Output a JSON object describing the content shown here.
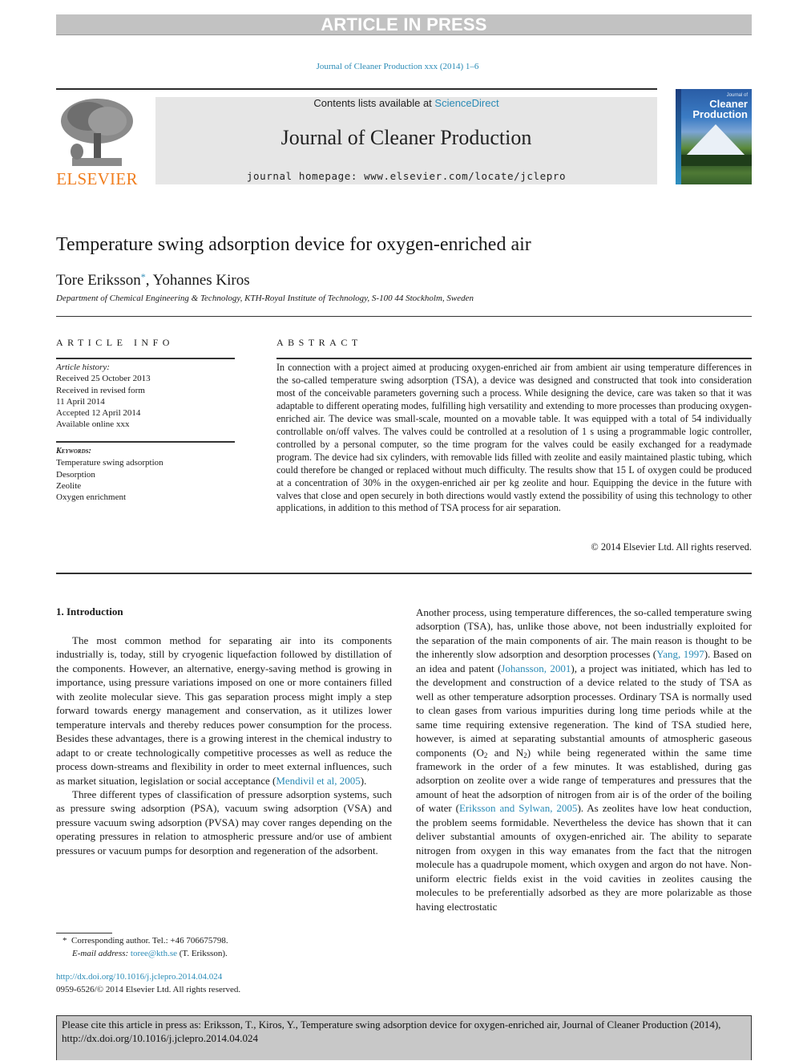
{
  "banner": {
    "text": "ARTICLE IN PRESS"
  },
  "journal_ref": "Journal of Cleaner Production xxx (2014) 1–6",
  "masthead": {
    "publisher_logo_text": "ELSEVIER",
    "contents_prefix": "Contents lists available at ",
    "contents_link": "ScienceDirect",
    "journal_title": "Journal of Cleaner Production",
    "homepage": "journal homepage: www.elsevier.com/locate/jclepro",
    "cover": {
      "small": "Journal of",
      "line1": "Cleaner",
      "line2": "Production"
    }
  },
  "article": {
    "title": "Temperature swing adsorption device for oxygen-enriched air",
    "author1": "Tore Eriksson",
    "author_marker": "*",
    "author_sep": ", ",
    "author2": "Yohannes Kiros",
    "affiliation": "Department of Chemical Engineering & Technology, KTH-Royal Institute of Technology, S-100 44 Stockholm, Sweden"
  },
  "article_info": {
    "heading": "ARTICLE INFO",
    "history_label": "Article history:",
    "history": [
      "Received 25 October 2013",
      "Received in revised form",
      "11 April 2014",
      "Accepted 12 April 2014",
      "Available online xxx"
    ],
    "keywords_label": "Keywords:",
    "keywords": [
      "Temperature swing adsorption",
      "Desorption",
      "Zeolite",
      "Oxygen enrichment"
    ]
  },
  "abstract": {
    "heading": "ABSTRACT",
    "text": "In connection with a project aimed at producing oxygen-enriched air from ambient air using temperature differences in the so-called temperature swing adsorption (TSA), a device was designed and constructed that took into consideration most of the conceivable parameters governing such a process. While designing the device, care was taken so that it was adaptable to different operating modes, fulfilling high versatility and extending to more processes than producing oxygen-enriched air. The device was small-scale, mounted on a movable table. It was equipped with a total of 54 individually controllable on/off valves. The valves could be controlled at a resolution of 1 s using a programmable logic controller, controlled by a personal computer, so the time program for the valves could be easily exchanged for a readymade program. The device had six cylinders, with removable lids filled with zeolite and easily maintained plastic tubing, which could therefore be changed or replaced without much difficulty. The results show that 15 L of oxygen could be produced at a concentration of 30% in the oxygen-enriched air per kg zeolite and hour. Equipping the device in the future with valves that close and open securely in both directions would vastly extend the possibility of using this technology to other applications, in addition to this method of TSA process for air separation.",
    "copyright": "© 2014 Elsevier Ltd. All rights reserved."
  },
  "body": {
    "section_heading": "1.  Introduction",
    "left": {
      "p1_a": "The most common method for separating air into its components industrially is, today, still by cryogenic liquefaction followed by distillation of the components. However, an alternative, energy-saving method is growing in importance, using pressure variations imposed on one or more containers filled with zeolite molecular sieve. This gas separation process might imply a step forward towards energy management and conservation, as it utilizes lower temperature intervals and thereby reduces power consumption for the process. Besides these advantages, there is a growing interest in the chemical industry to adapt to or create technologically competitive processes as well as reduce the process down-streams and flexibility in order to meet external influences, such as market situation, legislation or social acceptance (",
      "p1_cite": "Mendivil et al, 2005",
      "p1_b": ").",
      "p2": "Three different types of classification of pressure adsorption systems, such as pressure swing adsorption (PSA), vacuum swing adsorption (VSA) and pressure vacuum swing adsorption (PVSA) may cover ranges depending on the operating pressures in relation to atmospheric pressure and/or use of ambient pressures or vacuum pumps for desorption and regeneration of the adsorbent."
    },
    "right": {
      "t1": "Another process, using temperature differences, the so-called temperature swing adsorption (TSA), has, unlike those above, not been industrially exploited for the separation of the main components of air. The main reason is thought to be the inherently slow adsorption and desorption processes (",
      "c1": "Yang, 1997",
      "t2": "). Based on an idea and patent (",
      "c2": "Johansson, 2001",
      "t3": "), a project was initiated, which has led to the development and construction of a device related to the study of TSA as well as other temperature adsorption processes. Ordinary TSA is normally used to clean gases from various impurities during long time periods while at the same time requiring extensive regeneration. The kind of TSA studied here, however, is aimed at separating substantial amounts of atmospheric gaseous components (O",
      "sub1": "2",
      "t4": " and N",
      "sub2": "2",
      "t5": ") while being regenerated within the same time framework in the order of a few minutes. It was established, during gas adsorption on zeolite over a wide range of temperatures and pressures that the amount of heat the adsorption of nitrogen from air is of the order of the boiling of water (",
      "c3": "Eriksson and Sylwan, 2005",
      "t6": "). As zeolites have low heat conduction, the problem seems formidable. Nevertheless the device has shown that it can deliver substantial amounts of oxygen-enriched air. The ability to separate nitrogen from oxygen in this way emanates from the fact that the nitrogen molecule has a quadrupole moment, which oxygen and argon do not have. Non-uniform electric fields exist in the void cavities in zeolites causing the molecules to be preferentially adsorbed as they are more polarizable as those having electrostatic"
    }
  },
  "footnotes": {
    "marker": "*",
    "corresponding": "Corresponding author. Tel.: +46 706675798.",
    "email_label": "E-mail address:",
    "email": "toree@kth.se",
    "email_suffix": " (T. Eriksson).",
    "doi": "http://dx.doi.org/10.1016/j.jclepro.2014.04.024",
    "issn": "0959-6526/© 2014 Elsevier Ltd. All rights reserved."
  },
  "citation_box": {
    "text": "Please cite this article in press as: Eriksson, T., Kiros, Y., Temperature swing adsorption device for oxygen-enriched air, Journal of Cleaner Production (2014), http://dx.doi.org/10.1016/j.jclepro.2014.04.024"
  }
}
